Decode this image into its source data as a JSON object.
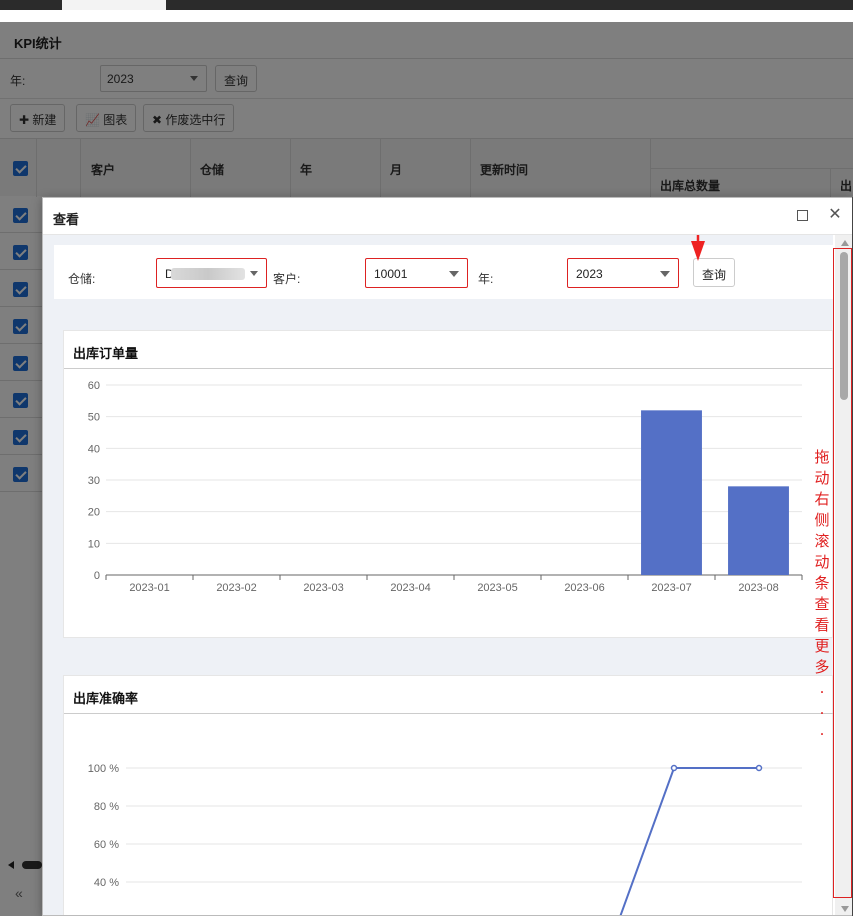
{
  "background": {
    "page_title": "KPI统计",
    "year_label": "年:",
    "year_value": "2023",
    "query_label": "查询",
    "toolbar": {
      "new_label": "新建",
      "chart_label": "图表",
      "void_label": "作废选中行"
    },
    "table_headers": {
      "customer": "客户",
      "warehouse": "仓储",
      "year": "年",
      "month": "月",
      "updated": "更新时间",
      "outbound_total": "出库总数量",
      "cut": "出"
    }
  },
  "modal": {
    "title": "查看",
    "filters": {
      "warehouse_label": "仓储:",
      "warehouse_value": "D",
      "customer_label": "客户:",
      "customer_value": "10001",
      "year_label": "年:",
      "year_value": "2023",
      "query_label": "查询"
    },
    "annotation": "拖动右侧滚动条查看更多...",
    "accent_color": "#5470c6",
    "highlight_color": "#dd2222"
  },
  "chart_data": [
    {
      "type": "bar",
      "title": "出库订单量",
      "categories": [
        "2023-01",
        "2023-02",
        "2023-03",
        "2023-04",
        "2023-05",
        "2023-06",
        "2023-07",
        "2023-08"
      ],
      "values": [
        0,
        0,
        0,
        0,
        0,
        0,
        52,
        28
      ],
      "ylim": [
        0,
        60
      ],
      "yticks": [
        "0",
        "10",
        "20",
        "30",
        "40",
        "50",
        "60"
      ],
      "grid": true
    },
    {
      "type": "line",
      "title": "出库准确率",
      "yticks_visible": [
        "40 %",
        "60 %",
        "80 %",
        "100 %"
      ],
      "points_visible_pct": [
        100,
        100
      ],
      "grid": true
    }
  ]
}
